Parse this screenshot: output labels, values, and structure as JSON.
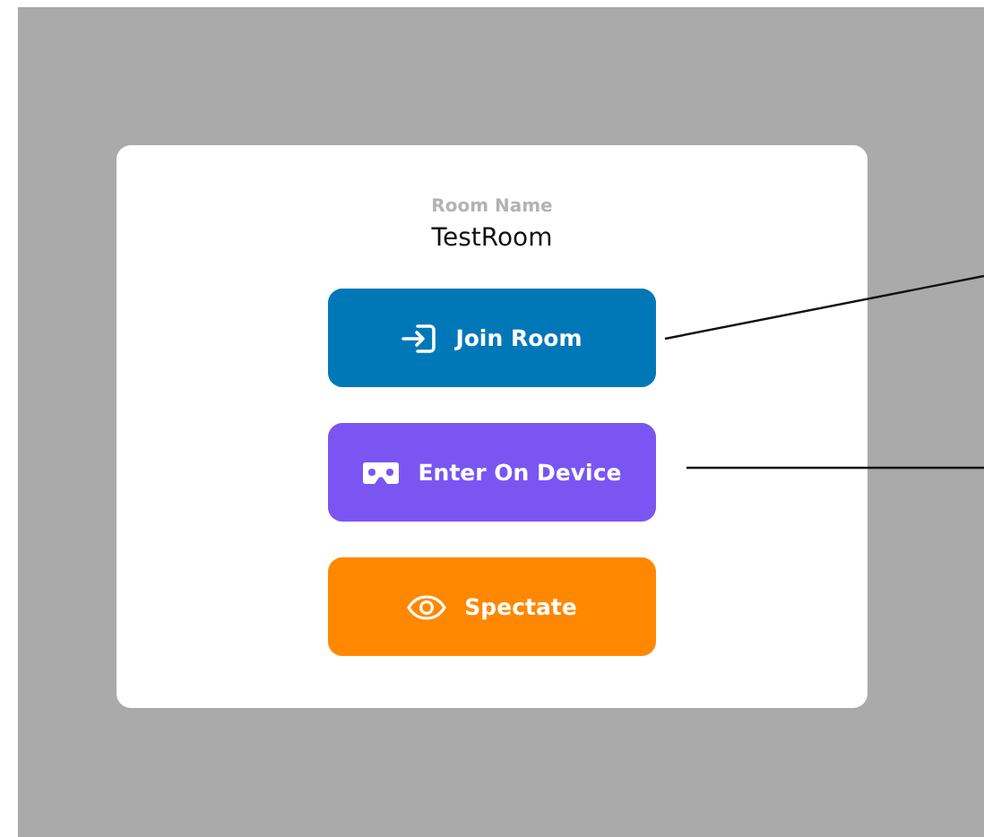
{
  "room": {
    "label": "Room Name",
    "name": "TestRoom"
  },
  "buttons": [
    {
      "kind": "join",
      "label": "Join Room",
      "color": "#0078b8"
    },
    {
      "kind": "device",
      "label": "Enter On Device",
      "color": "#7a55f2"
    },
    {
      "kind": "spectate",
      "label": "Spectate",
      "color": "#ff8800"
    }
  ]
}
